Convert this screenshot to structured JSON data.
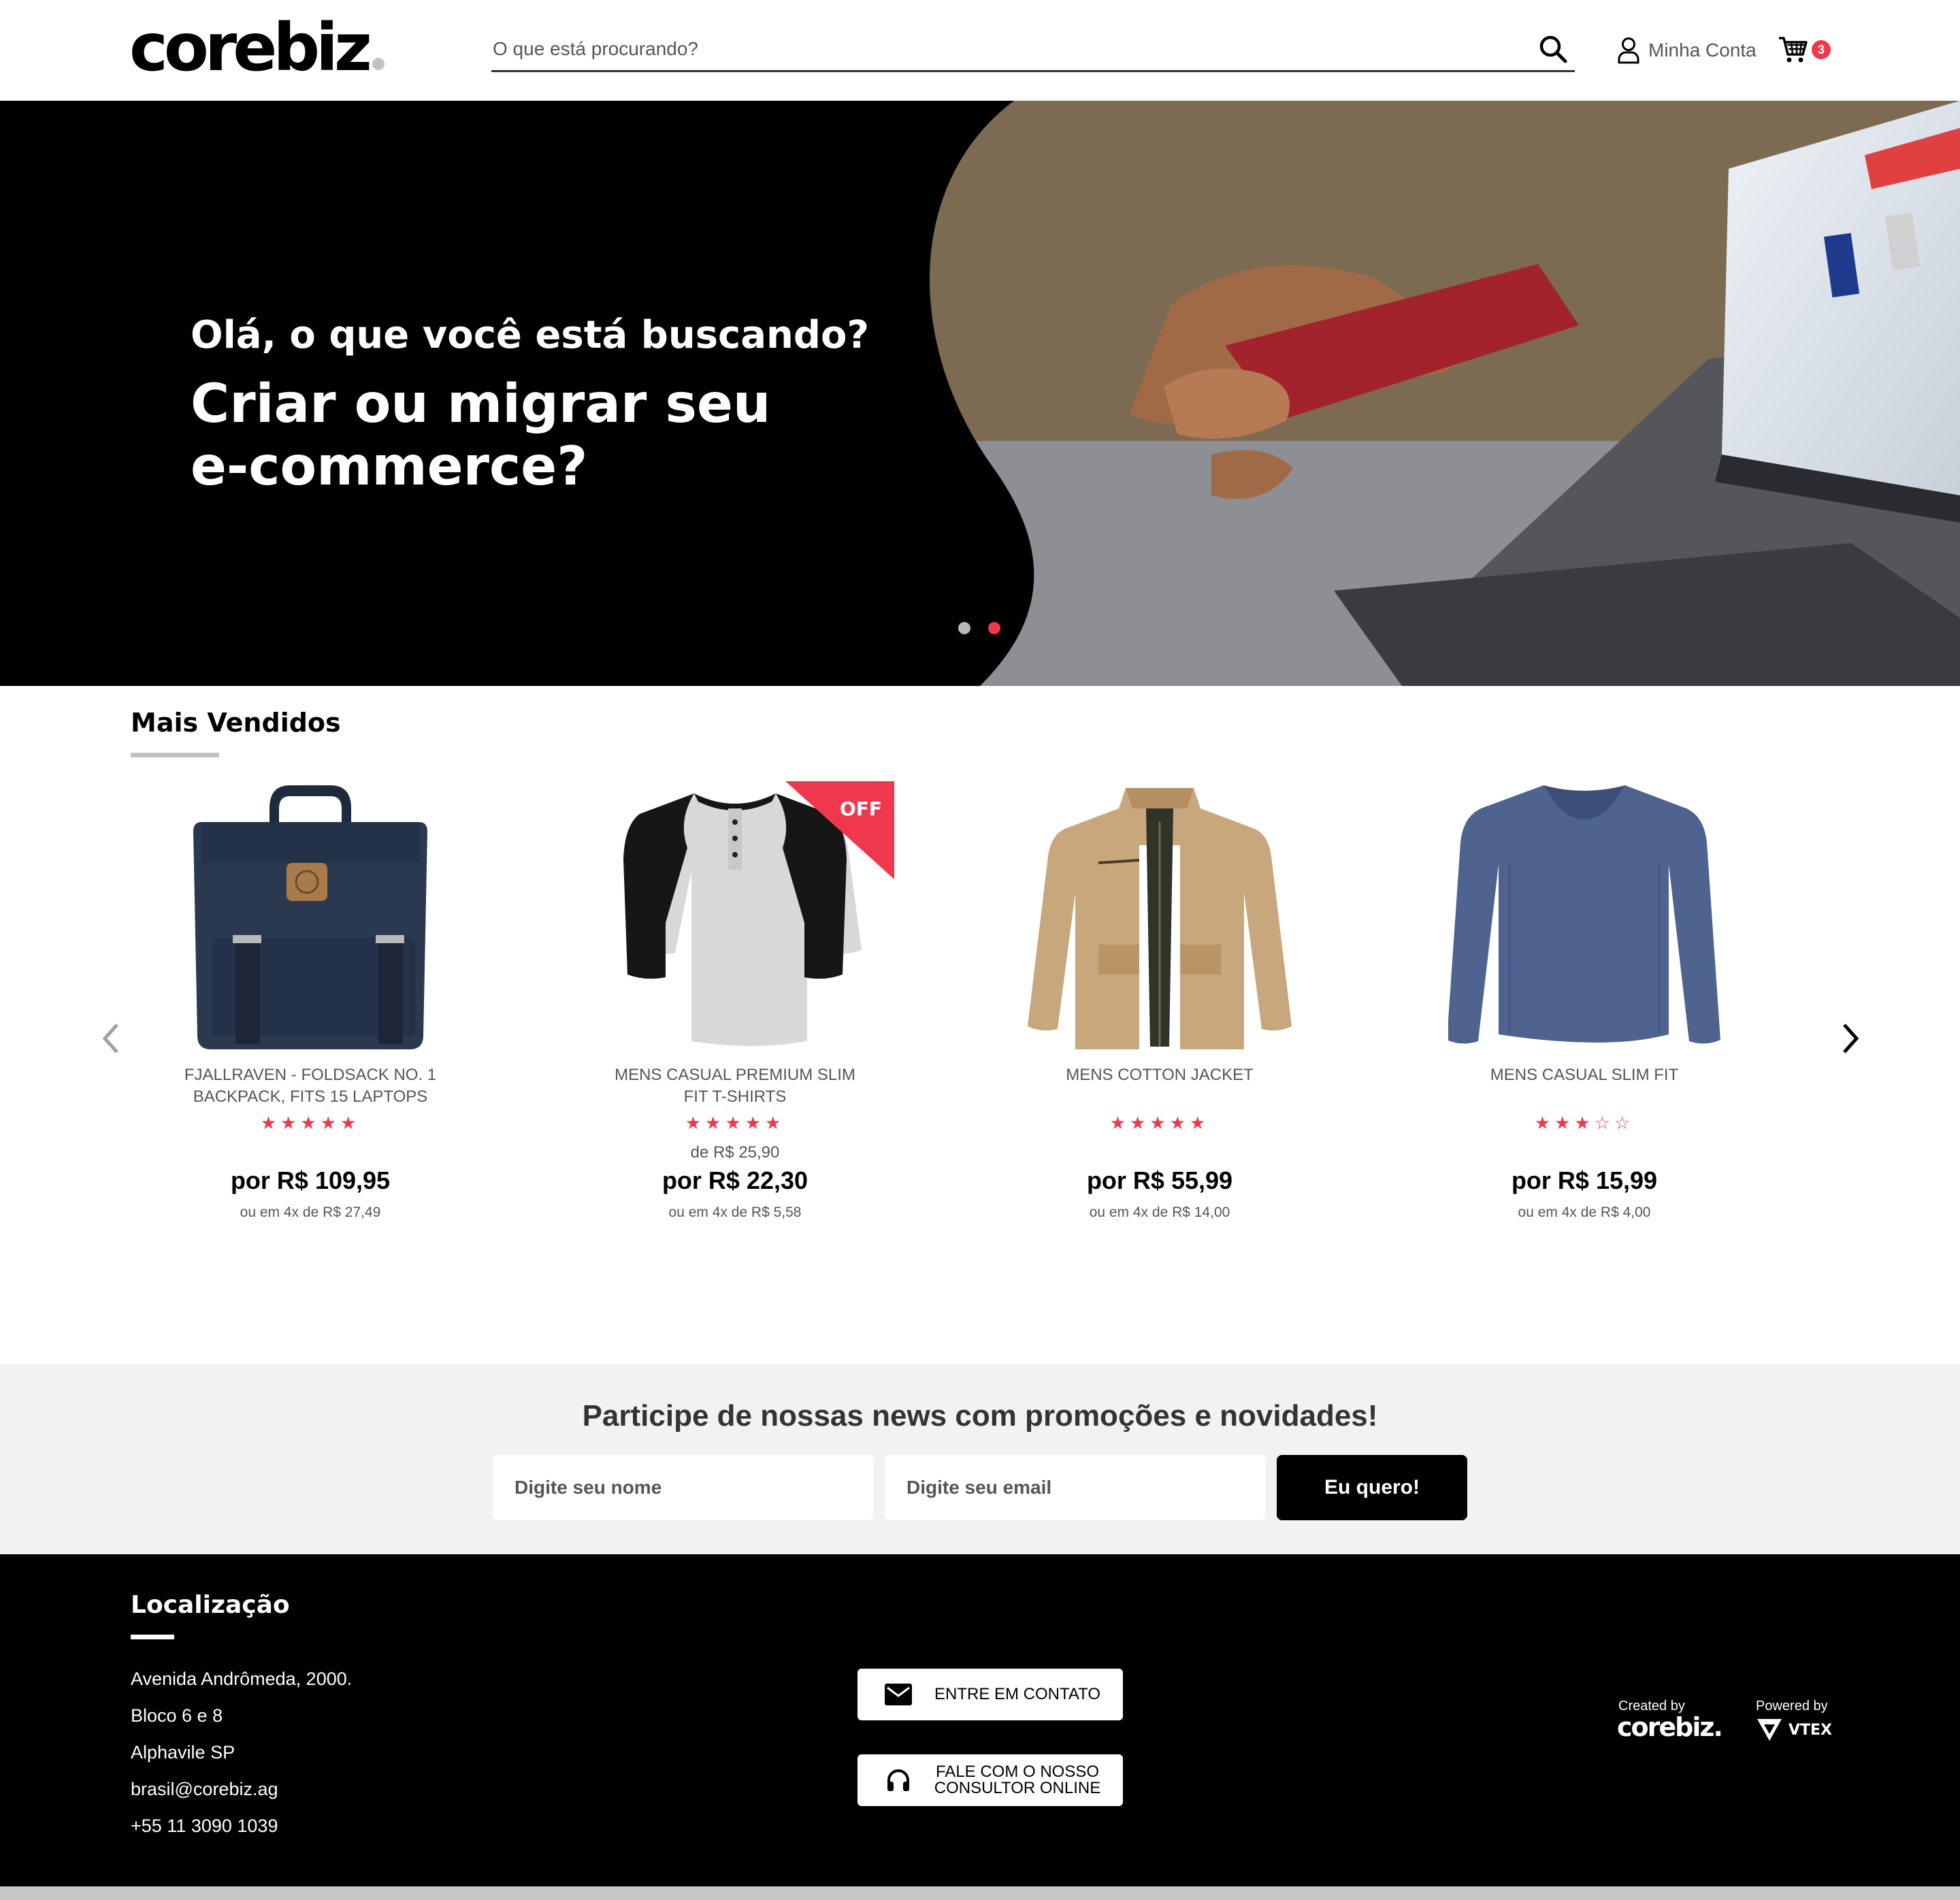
{
  "header": {
    "logo_text": "corebiz",
    "search_placeholder": "O que está procurando?",
    "account_label": "Minha Conta",
    "cart_count": "3"
  },
  "hero": {
    "subtitle": "Olá, o que você está buscando?",
    "title_line1": "Criar ou migrar seu",
    "title_line2": "e-commerce?",
    "slides": 2,
    "active_slide": 2
  },
  "products": {
    "title": "Mais Vendidos",
    "items": [
      {
        "name_line1": "FJALLRAVEN - FOLDSACK NO. 1",
        "name_line2": "BACKPACK, FITS 15 LAPTOPS",
        "rating": 5,
        "stars": "★★★★★",
        "old_price": "",
        "price": "por R$ 109,95",
        "installments": "ou em 4x de R$ 27,49",
        "badge": "",
        "image_icon": "backpack-image"
      },
      {
        "name_line1": "MENS CASUAL PREMIUM SLIM",
        "name_line2": "FIT T-SHIRTS",
        "rating": 5,
        "stars": "★★★★★",
        "old_price": "de R$ 25,90",
        "price": "por R$ 22,30",
        "installments": "ou em 4x de R$ 5,58",
        "badge": "OFF",
        "image_icon": "tshirt-image"
      },
      {
        "name_line1": "MENS COTTON JACKET",
        "name_line2": "",
        "rating": 5,
        "stars": "★★★★★",
        "old_price": "",
        "price": "por R$ 55,99",
        "installments": "ou em 4x de R$ 14,00",
        "badge": "",
        "image_icon": "jacket-image"
      },
      {
        "name_line1": "MENS CASUAL SLIM FIT",
        "name_line2": "",
        "rating": 3,
        "stars": "★★★☆☆",
        "old_price": "",
        "price": "por R$ 15,99",
        "installments": "ou em 4x de R$ 4,00",
        "badge": "",
        "image_icon": "longsleeve-image"
      }
    ]
  },
  "newsletter": {
    "title": "Participe de nossas news com promoções e novidades!",
    "name_placeholder": "Digite seu nome",
    "email_placeholder": "Digite seu email",
    "button_label": "Eu quero!"
  },
  "footer": {
    "title": "Localização",
    "address_lines": [
      "Avenida Andrômeda, 2000.",
      "Bloco 6 e 8",
      "Alphavile SP",
      "brasil@corebiz.ag",
      "+55 11 3090 1039"
    ],
    "contact_button": "ENTRE EM CONTATO",
    "consultant_line1": "FALE COM O NOSSO",
    "consultant_line2": "CONSULTOR ONLINE",
    "created_by": "Created by",
    "created_logo": "corebiz.",
    "powered_by": "Powered by",
    "powered_logo": "VTEX"
  },
  "colors": {
    "accent": "#f0384d",
    "dark": "#000000",
    "muted_text": "#555555",
    "newsletter_bg": "#f2f2f2",
    "divider": "#c2c2c2"
  }
}
